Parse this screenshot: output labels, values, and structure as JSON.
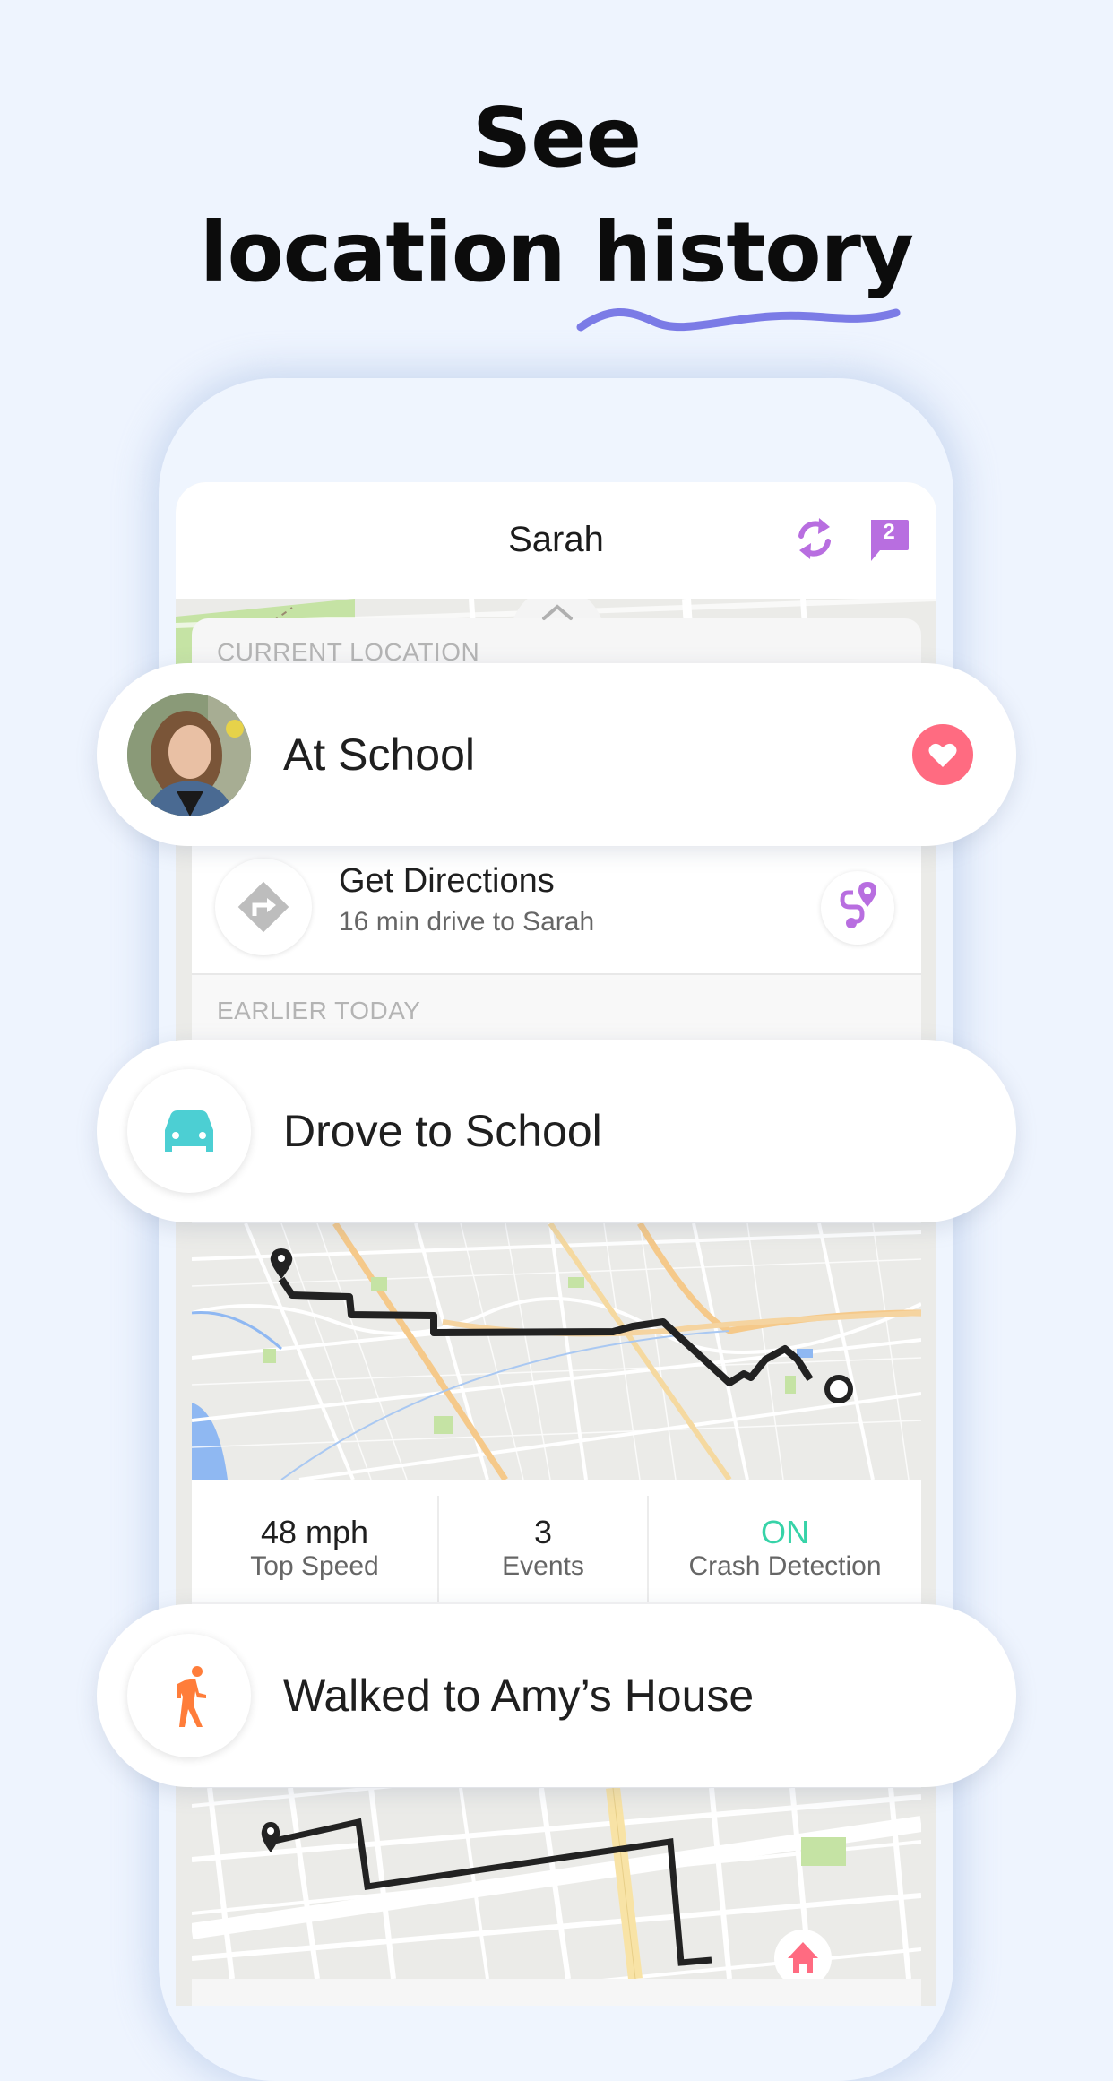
{
  "headline": {
    "line1": "See",
    "line2": "location history",
    "underline_color": "#7b7be6"
  },
  "app": {
    "title": "Sarah",
    "messages_badge": "2",
    "accent_color": "#b86ee0"
  },
  "current_location": {
    "section_label": "CURRENT LOCATION",
    "status": "At School",
    "favorite_color": "#ff6b81"
  },
  "directions": {
    "title": "Get Directions",
    "subtitle": "16 min drive to Sarah"
  },
  "earlier_today": {
    "section_label": "EARLIER TODAY"
  },
  "drive": {
    "title": "Drove to School",
    "icon_color": "#4ccfd3",
    "stats": [
      {
        "value": "48 mph",
        "label": "Top Speed"
      },
      {
        "value": "3",
        "label": "Events"
      },
      {
        "value": "ON",
        "label": "Crash Detection",
        "value_color": "#37d3a8"
      }
    ]
  },
  "walk": {
    "title": "Walked to Amy’s House",
    "icon_color": "#ff7d3a",
    "destination_icon_color": "#ff6b81"
  }
}
